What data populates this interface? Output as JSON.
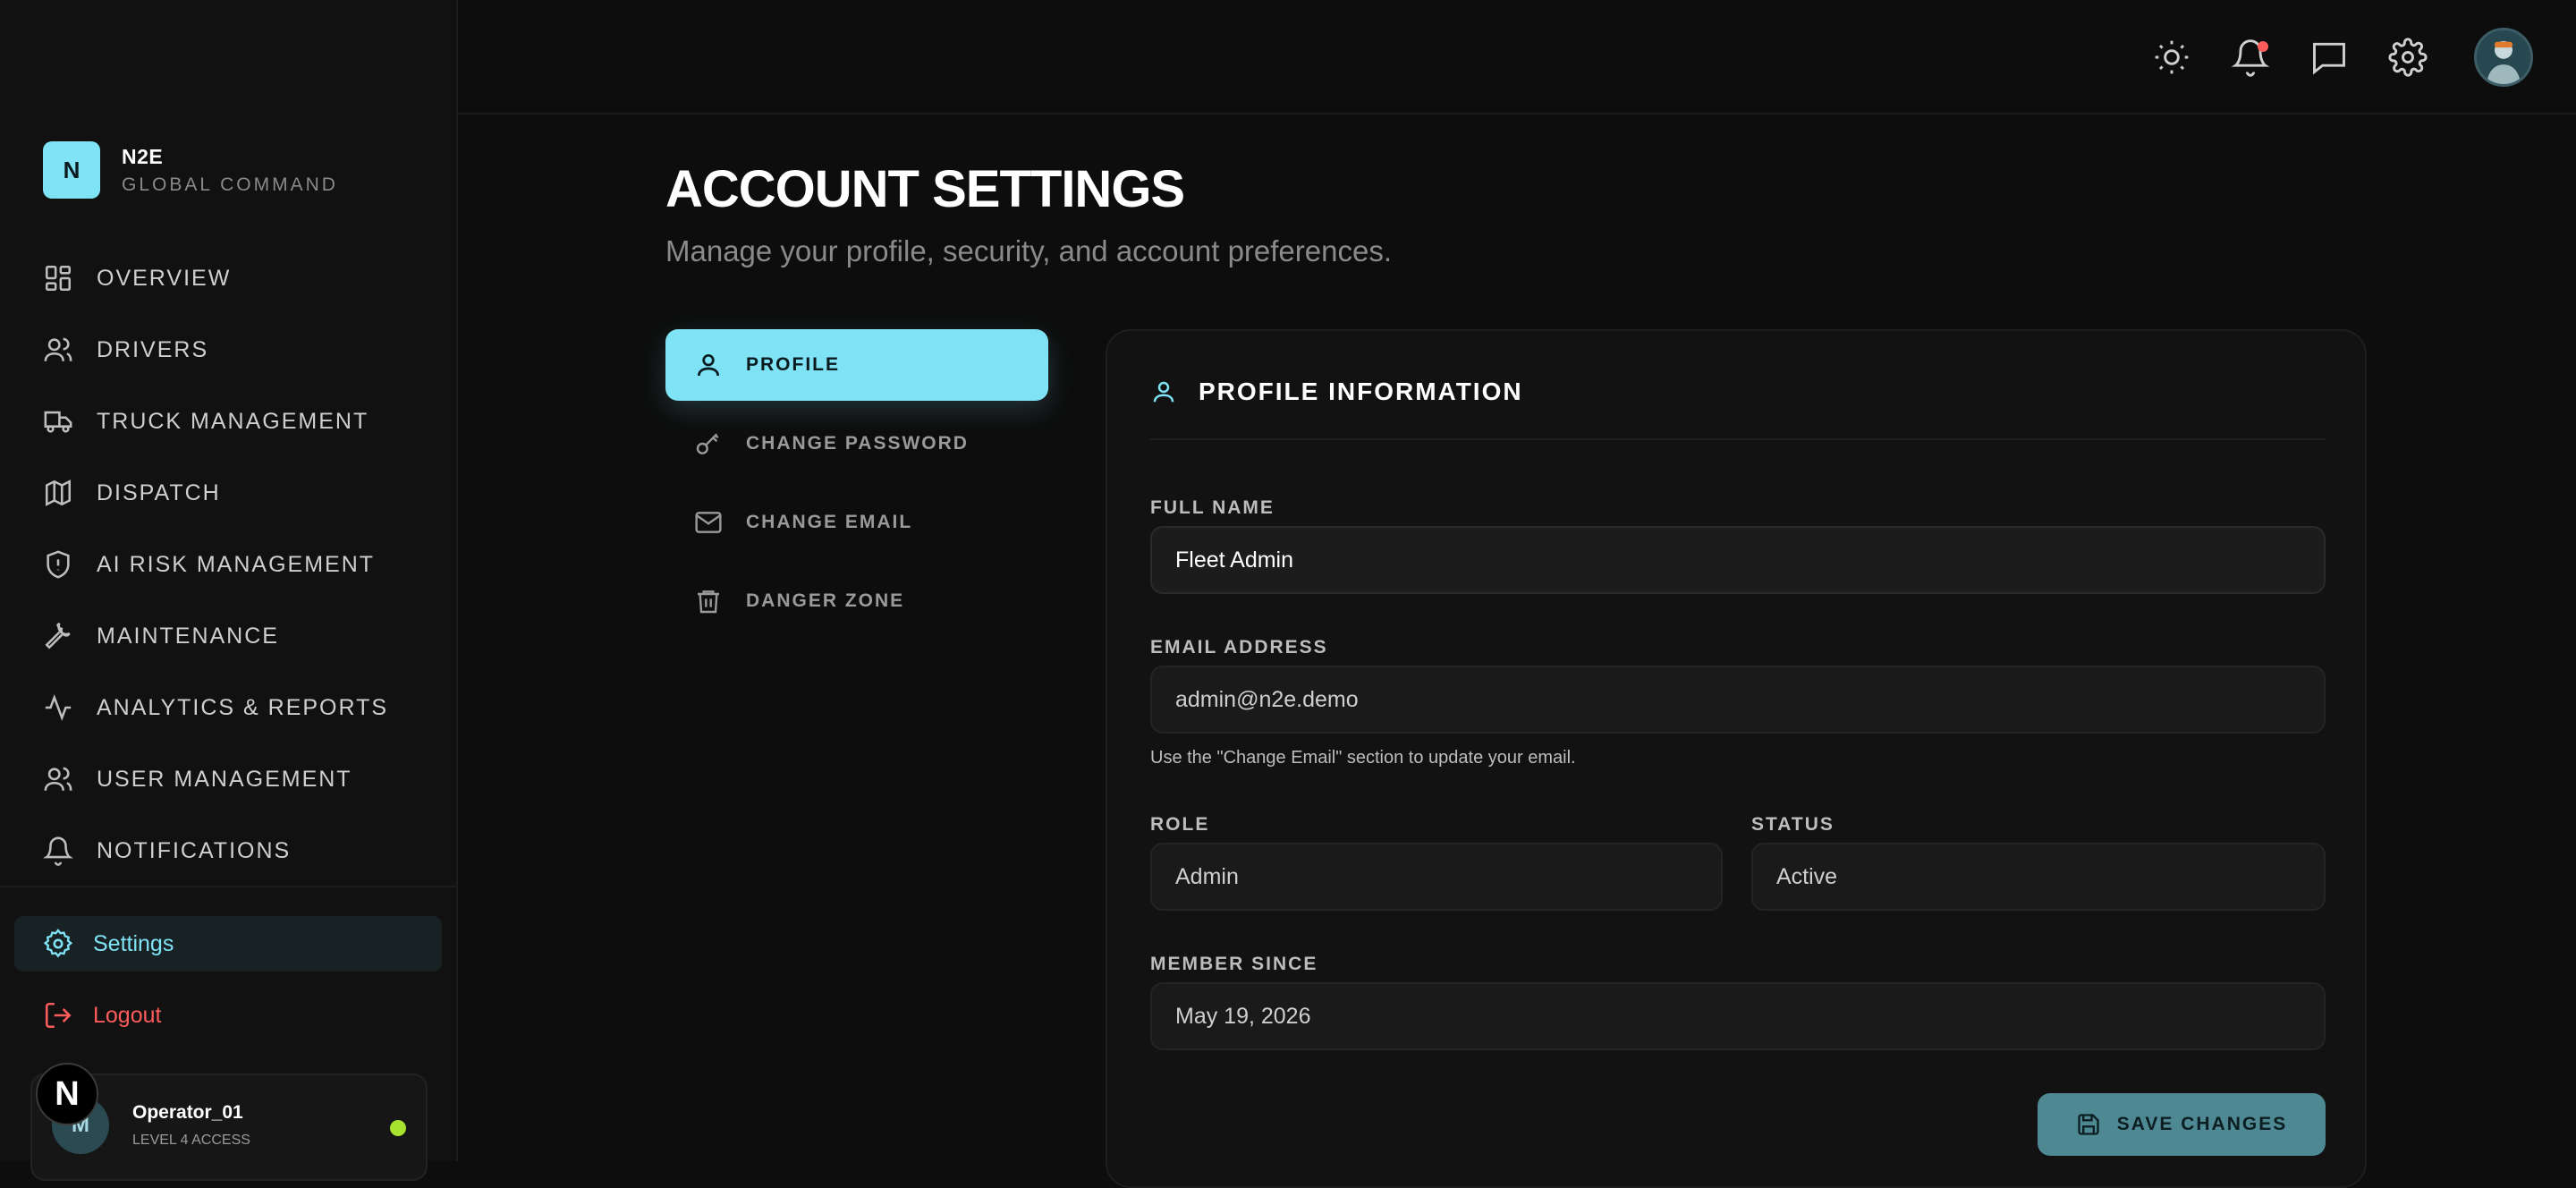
{
  "brand": {
    "logo_letter": "N",
    "name": "N2E",
    "subtitle": "GLOBAL COMMAND"
  },
  "sidebar": {
    "items": [
      {
        "label": "OVERVIEW",
        "icon": "dashboard-icon"
      },
      {
        "label": "DRIVERS",
        "icon": "users-icon"
      },
      {
        "label": "TRUCK MANAGEMENT",
        "icon": "truck-icon"
      },
      {
        "label": "DISPATCH",
        "icon": "map-icon"
      },
      {
        "label": "AI RISK MANAGEMENT",
        "icon": "shield-alert-icon"
      },
      {
        "label": "MAINTENANCE",
        "icon": "wrench-icon"
      },
      {
        "label": "ANALYTICS & REPORTS",
        "icon": "activity-icon"
      },
      {
        "label": "USER MANAGEMENT",
        "icon": "users-icon"
      },
      {
        "label": "NOTIFICATIONS",
        "icon": "bell-icon"
      }
    ],
    "settings_label": "Settings",
    "logout_label": "Logout"
  },
  "user": {
    "avatar_letter": "M",
    "name": "Operator_01",
    "level": "LEVEL 4 ACCESS",
    "status_color": "#a7e22e"
  },
  "dev_badge": "N",
  "page": {
    "title": "ACCOUNT SETTINGS",
    "subtitle": "Manage your profile, security, and account preferences."
  },
  "tabs": [
    {
      "label": "PROFILE",
      "icon": "user-icon",
      "active": true
    },
    {
      "label": "CHANGE PASSWORD",
      "icon": "key-icon",
      "active": false
    },
    {
      "label": "CHANGE EMAIL",
      "icon": "mail-icon",
      "active": false
    },
    {
      "label": "DANGER ZONE",
      "icon": "trash-icon",
      "active": false
    }
  ],
  "profile": {
    "title": "PROFILE INFORMATION",
    "full_name_label": "FULL NAME",
    "full_name": "Fleet Admin",
    "email_label": "EMAIL ADDRESS",
    "email": "admin@n2e.demo",
    "email_hint": "Use the \"Change Email\" section to update your email.",
    "role_label": "ROLE",
    "role": "Admin",
    "status_label": "STATUS",
    "status": "Active",
    "member_since_label": "MEMBER SINCE",
    "member_since": "May 19, 2026",
    "save_label": "SAVE CHANGES"
  },
  "colors": {
    "accent": "#7fe3f5",
    "danger": "#ff5c5c",
    "online": "#a7e22e",
    "background": "#0d0d0d"
  }
}
